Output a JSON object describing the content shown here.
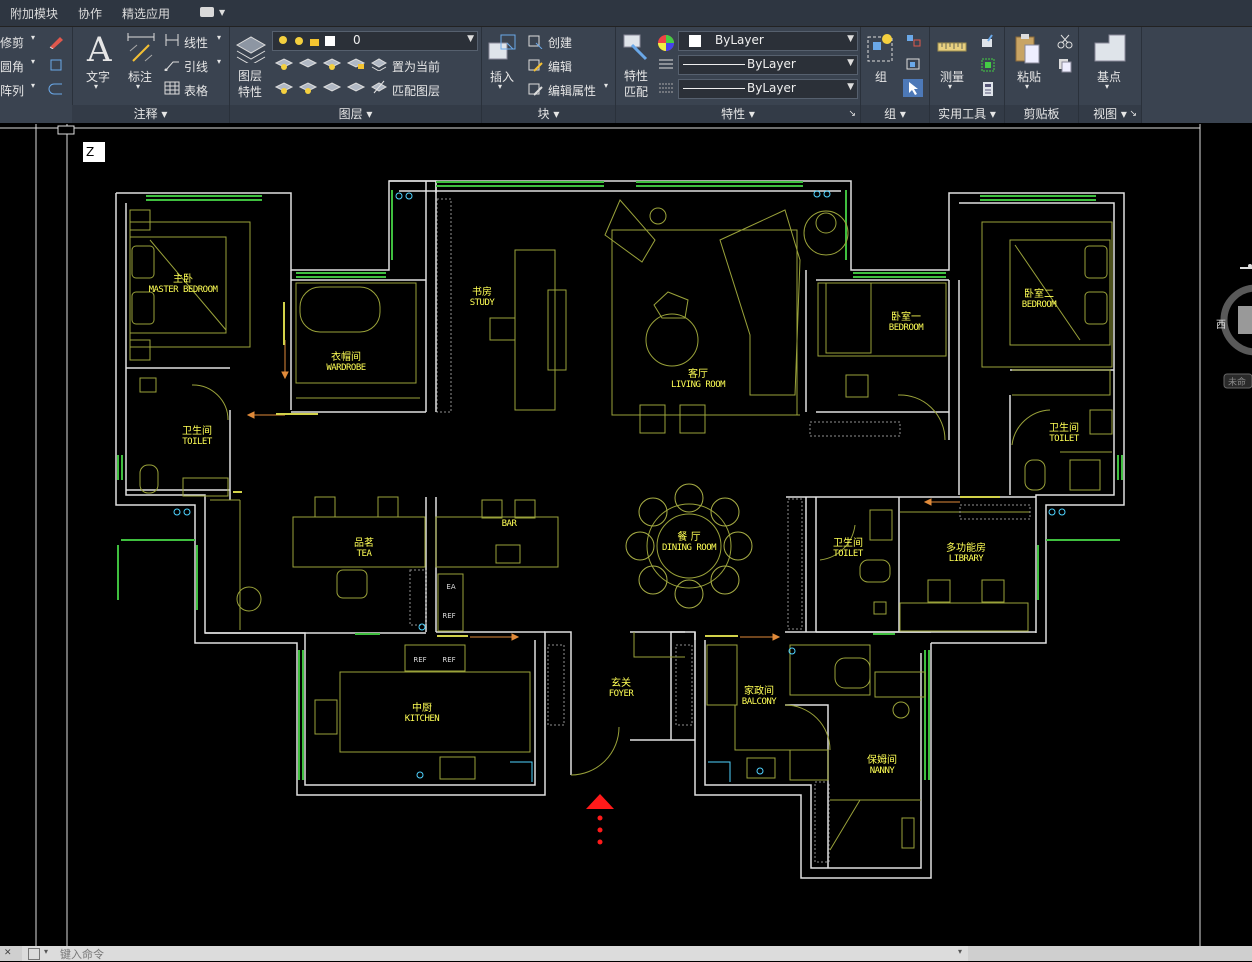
{
  "menu": {
    "items": [
      "附加模块",
      "协作",
      "精选应用"
    ]
  },
  "ribbon": {
    "modify_partial": [
      "修剪",
      "圆角",
      "阵列"
    ],
    "annotation": {
      "title": "注释",
      "text_label": "文字",
      "dim_label": "标注",
      "linear": "线性",
      "leader": "引线",
      "table": "表格"
    },
    "layers": {
      "title": "图层",
      "props_label": "图层\n特性",
      "current_layer": "0",
      "set_current": "置为当前",
      "match_layer": "匹配图层"
    },
    "block": {
      "title": "块",
      "insert": "插入",
      "create": "创建",
      "edit": "编辑",
      "edit_attr": "编辑属性"
    },
    "properties": {
      "title": "特性",
      "match_label": "特性\n匹配",
      "color": "ByLayer",
      "linetype": "ByLayer",
      "lineweight": "ByLayer"
    },
    "groups": {
      "title": "组",
      "group": "组"
    },
    "utilities": {
      "title": "实用工具",
      "measure": "测量"
    },
    "clipboard": {
      "title": "剪贴板",
      "paste": "粘贴"
    },
    "view": {
      "title": "视图",
      "base": "基点"
    }
  },
  "viewcube": {
    "west": "西",
    "unnamed": "未命"
  },
  "drawing": {
    "ztag": "Z",
    "rooms": [
      {
        "zh": "主卧",
        "en": "MASTER BEDROOM"
      },
      {
        "zh": "衣帽间",
        "en": "WARDROBE"
      },
      {
        "zh": "书房",
        "en": "STUDY"
      },
      {
        "zh": "客厅",
        "en": "LIVING ROOM"
      },
      {
        "zh": "卧室一",
        "en": "BEDROOM"
      },
      {
        "zh": "卧室二",
        "en": "BEDROOM"
      },
      {
        "zh": "卫生间",
        "en": "TOILET"
      },
      {
        "zh": "卫生间",
        "en": "TOILET"
      },
      {
        "zh": "品茗",
        "en": "TEA"
      },
      {
        "zh": "",
        "en": "BAR"
      },
      {
        "zh": "餐 厅",
        "en": "DINING ROOM"
      },
      {
        "zh": "卫生间",
        "en": "TOILET"
      },
      {
        "zh": "多功能房",
        "en": "LIBRARY"
      },
      {
        "zh": "中厨",
        "en": "KITCHEN"
      },
      {
        "zh": "玄关",
        "en": "FOYER"
      },
      {
        "zh": "家政间",
        "en": "BALCONY"
      },
      {
        "zh": "保姆间",
        "en": "NANNY"
      }
    ],
    "appliances": [
      "EA",
      "REF",
      "REF",
      "REF"
    ]
  },
  "command": {
    "placeholder": "键入命令"
  }
}
